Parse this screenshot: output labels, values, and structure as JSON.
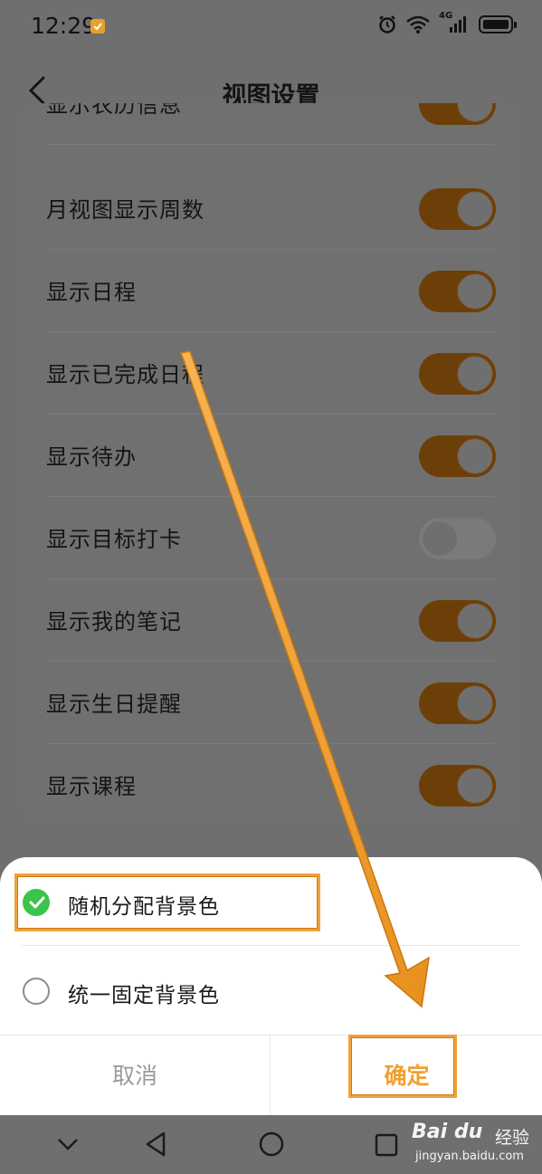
{
  "status_bar": {
    "time": "12:29",
    "network": "4G",
    "icons": [
      "notification-check-icon",
      "alarm-icon",
      "wifi-icon",
      "signal-icon",
      "battery-icon"
    ]
  },
  "header": {
    "title": "视图设置",
    "back_icon": "back-chevron-icon"
  },
  "settings": {
    "rows": [
      {
        "label": "显示农历信息",
        "on": true
      },
      {
        "label": "月视图显示周数",
        "on": true
      },
      {
        "label": "显示日程",
        "on": true
      },
      {
        "label": "显示已完成日程",
        "on": true
      },
      {
        "label": "显示待办",
        "on": true
      },
      {
        "label": "显示目标打卡",
        "on": false
      },
      {
        "label": "显示我的笔记",
        "on": true
      },
      {
        "label": "显示生日提醒",
        "on": true
      },
      {
        "label": "显示课程",
        "on": true
      }
    ]
  },
  "sheet": {
    "options": [
      {
        "label": "随机分配背景色",
        "checked": true
      },
      {
        "label": "统一固定背景色",
        "checked": false
      }
    ],
    "cancel_label": "取消",
    "confirm_label": "确定"
  },
  "nav": {
    "icons": [
      "chevron-down-icon",
      "back-triangle-icon",
      "home-circle-icon",
      "recents-square-icon"
    ]
  },
  "watermark": {
    "logo": "Bai du",
    "brand": "经验",
    "url": "jingyan.baidu.com"
  },
  "colors": {
    "accent": "#f0a030",
    "toggle_on": "#6d3f08",
    "check_green": "#3bc44a",
    "annotation": "#f0a23a"
  }
}
